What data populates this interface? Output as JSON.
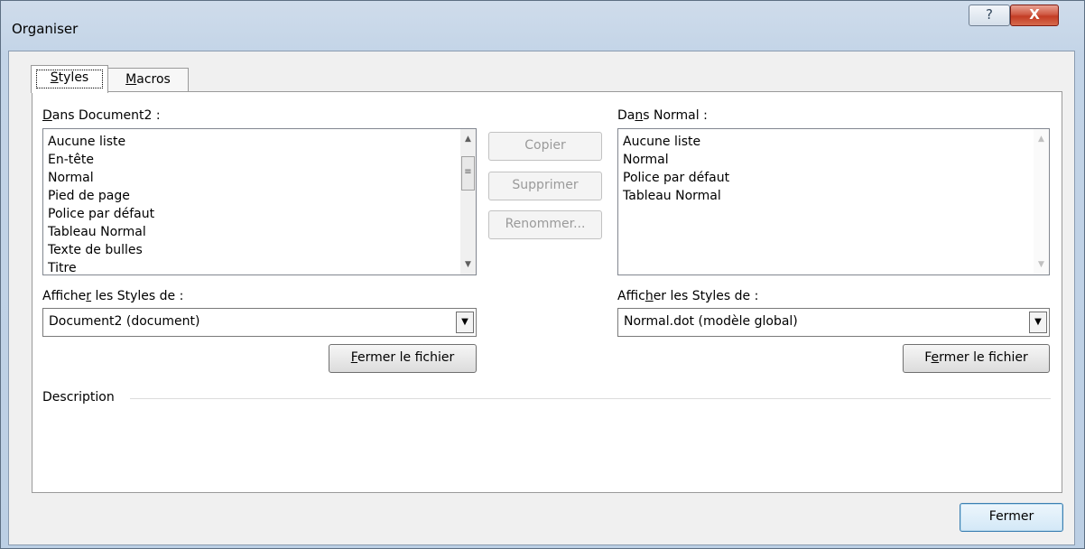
{
  "window": {
    "title": "Organiser",
    "help_glyph": "?",
    "close_glyph": "X"
  },
  "tabs": [
    {
      "label_prefix": "",
      "label_mnemonic": "S",
      "label_rest": "tyles"
    },
    {
      "label_prefix": "",
      "label_mnemonic": "M",
      "label_rest": "acros"
    }
  ],
  "left": {
    "list_label_prefix": "",
    "list_label_mnemonic": "D",
    "list_label_rest": "ans Document2 :",
    "items": [
      "Aucune liste",
      "En-tête",
      "Normal",
      "Pied de page",
      "Police par défaut",
      "Tableau Normal",
      "Texte de bulles",
      "Titre"
    ],
    "show_label_prefix": "Affiche",
    "show_label_mnemonic": "r",
    "show_label_rest": " les Styles de :",
    "combo_value": "Document2 (document)",
    "close_file_mnemonic": "F",
    "close_file_rest": "ermer le fichier"
  },
  "right": {
    "list_label_prefix": "Da",
    "list_label_mnemonic": "n",
    "list_label_rest": "s Normal :",
    "items": [
      "Aucune liste",
      "Normal",
      "Police par défaut",
      "Tableau Normal"
    ],
    "show_label_prefix": "Affic",
    "show_label_mnemonic": "h",
    "show_label_rest": "er les Styles de :",
    "combo_value": "Normal.dot (modèle global)",
    "close_file_prefix": "F",
    "close_file_mnemonic": "e",
    "close_file_rest": "rmer le fichier"
  },
  "middle": {
    "copy_label": "Copier",
    "delete_label": "Supprimer",
    "rename_label": "Renommer..."
  },
  "description": {
    "label": "Description"
  },
  "footer": {
    "close_label": "Fermer"
  },
  "icons": {
    "scroll_up": "▲",
    "scroll_down": "▼",
    "thumb_grip": "≡",
    "dropdown": "▼"
  }
}
